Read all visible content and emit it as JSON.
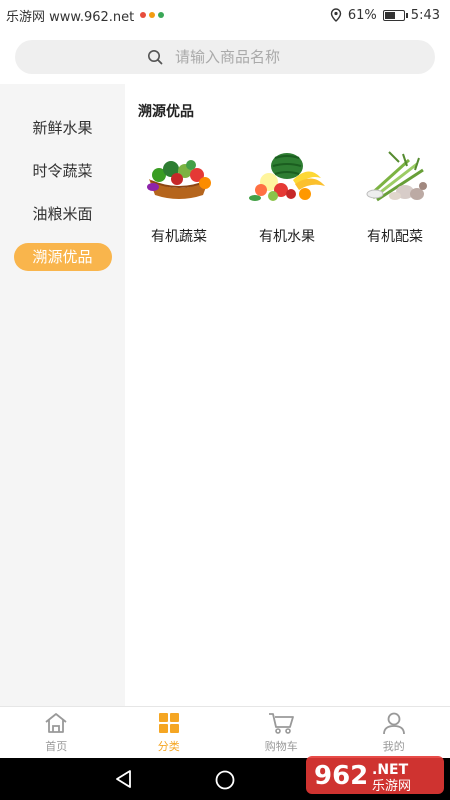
{
  "status_bar": {
    "site": "乐游网 www.962.net",
    "battery_text": "61%",
    "battery_level": 0.61,
    "time": "5:43"
  },
  "search": {
    "placeholder": "请输入商品名称"
  },
  "sidebar": {
    "items": [
      {
        "label": "新鲜水果"
      },
      {
        "label": "时令蔬菜"
      },
      {
        "label": "油粮米面"
      },
      {
        "label": "溯源优品"
      }
    ],
    "active_index": 3
  },
  "content": {
    "section_title": "溯源优品",
    "items": [
      {
        "label": "有机蔬菜",
        "icon": "vegetable-basket-icon"
      },
      {
        "label": "有机水果",
        "icon": "fruit-pile-icon"
      },
      {
        "label": "有机配菜",
        "icon": "side-vegetables-icon"
      }
    ]
  },
  "tabbar": {
    "tabs": [
      {
        "label": "首页",
        "icon": "home-icon"
      },
      {
        "label": "分类",
        "icon": "category-grid-icon"
      },
      {
        "label": "购物车",
        "icon": "cart-icon"
      },
      {
        "label": "我的",
        "icon": "user-icon"
      }
    ],
    "active_index": 1
  },
  "watermark": {
    "number": "962",
    "suffix": ".NET",
    "brand": "乐游网"
  },
  "colors": {
    "accent": "#f5a623",
    "pill": "#f9b54c",
    "sidebar_bg": "#f5f5f5"
  }
}
